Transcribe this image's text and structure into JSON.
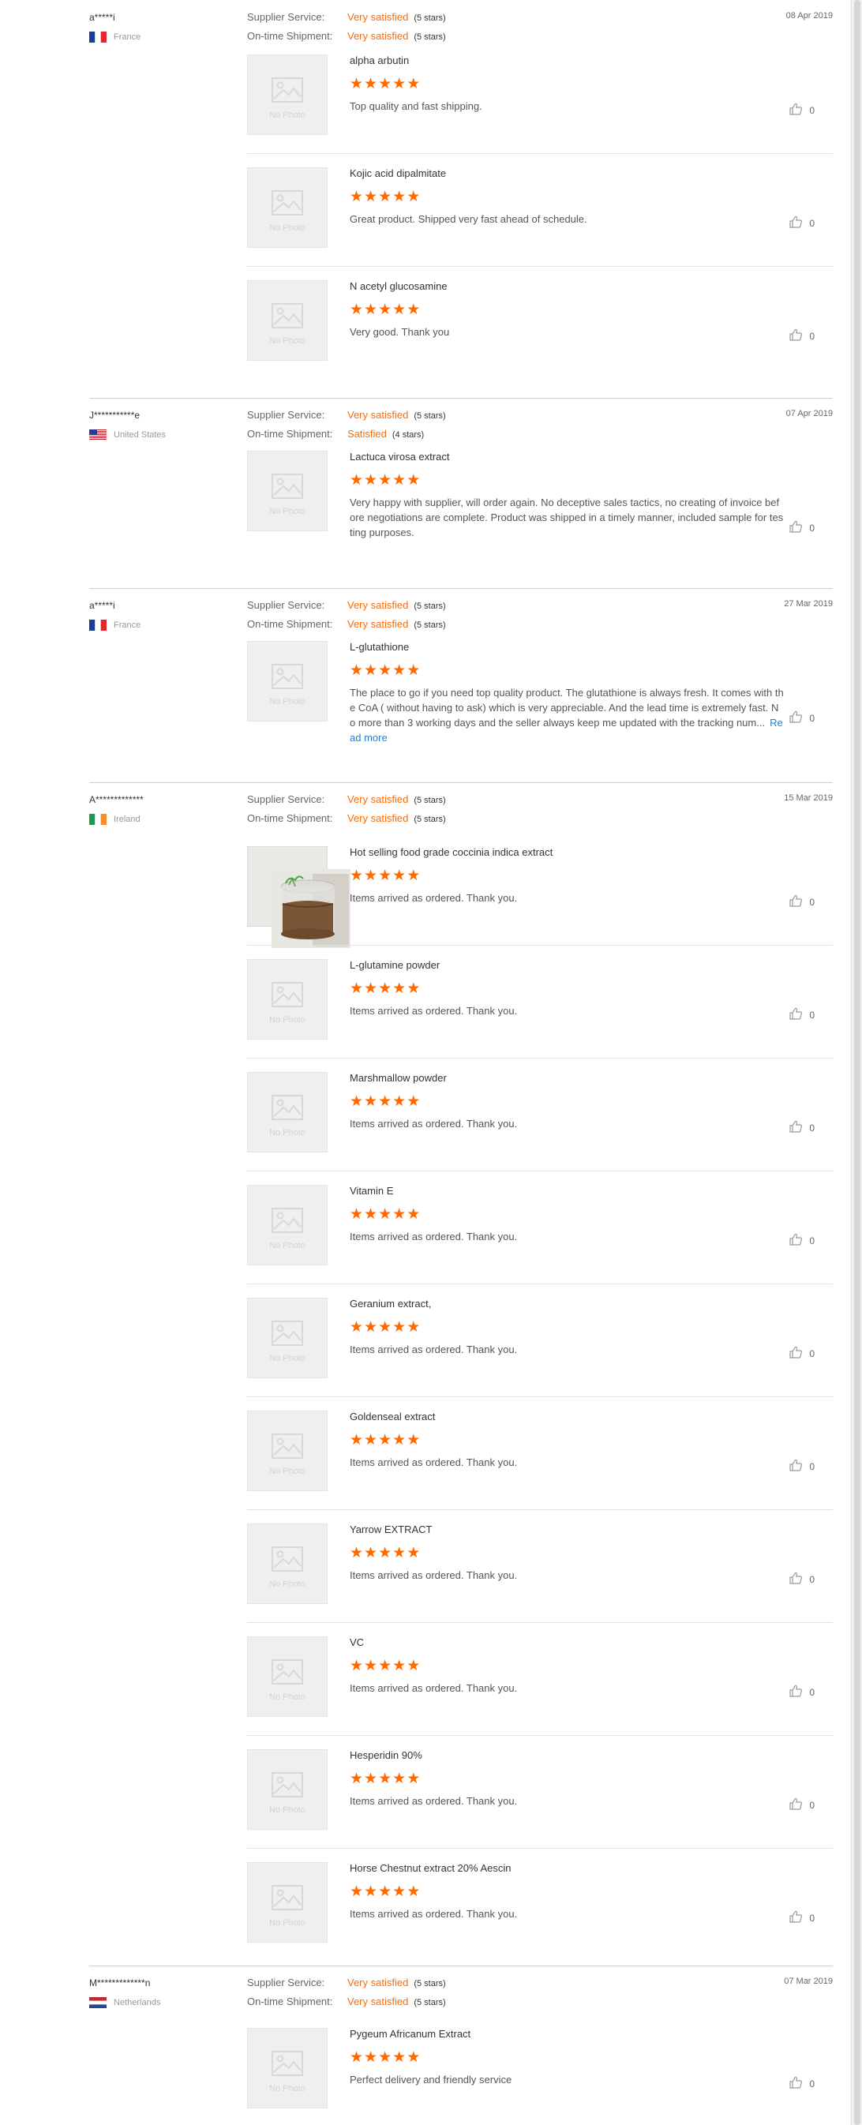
{
  "labels": {
    "supplier_service": "Supplier Service:",
    "ontime_shipment": "On-time Shipment:",
    "no_photo": "No Photo"
  },
  "reviews": [
    {
      "buyer": "a*****i",
      "country": "France",
      "flag": "france",
      "date": "08 Apr 2019",
      "supplier_service": {
        "value": "Very satisfied",
        "stars": "(5 stars)"
      },
      "ontime_shipment": {
        "value": "Very satisfied",
        "stars": "(5 stars)"
      },
      "items": [
        {
          "title": "alpha arbutin",
          "rating": 5,
          "text": "Top quality and fast shipping.",
          "likes": "0",
          "photo": "none"
        },
        {
          "title": "Kojic acid dipalmitate",
          "rating": 5,
          "text": "Great product. Shipped very fast ahead of schedule.",
          "likes": "0",
          "photo": "none"
        },
        {
          "title": "N acetyl glucosamine",
          "rating": 5,
          "text": "Very good. Thank you",
          "likes": "0",
          "photo": "none"
        }
      ]
    },
    {
      "buyer": "J***********e",
      "country": "United States",
      "flag": "usa",
      "date": "07 Apr 2019",
      "supplier_service": {
        "value": "Very satisfied",
        "stars": "(5 stars)"
      },
      "ontime_shipment": {
        "value": "Satisfied",
        "stars": "(4 stars)"
      },
      "items": [
        {
          "title": "Lactuca virosa extract",
          "rating": 5,
          "text": "Very happy with supplier, will order again. No deceptive sales tactics, no creating of invoice before negotiations are complete. Product was shipped in a timely manner, included sample for testing purposes.",
          "likes": "0",
          "photo": "none"
        }
      ]
    },
    {
      "buyer": "a*****i",
      "country": "France",
      "flag": "france",
      "date": "27 Mar 2019",
      "supplier_service": {
        "value": "Very satisfied",
        "stars": "(5 stars)"
      },
      "ontime_shipment": {
        "value": "Very satisfied",
        "stars": "(5 stars)"
      },
      "items": [
        {
          "title": "L-glutathione",
          "rating": 5,
          "text": "The place to go if you need top quality product. The glutathione is always fresh. It comes with the CoA ( without having to ask) which is very appreciable. And the lead time is extremely fast. No more than 3 working days and the seller always keep me updated with the tracking num...",
          "read_more": "Read more",
          "likes": "0",
          "photo": "none"
        }
      ]
    },
    {
      "buyer": "A*************",
      "country": "Ireland",
      "flag": "ireland",
      "date": "15 Mar 2019",
      "supplier_service": {
        "value": "Very satisfied",
        "stars": "(5 stars)"
      },
      "ontime_shipment": {
        "value": "Very satisfied",
        "stars": "(5 stars)"
      },
      "items": [
        {
          "title": "Hot selling food grade coccinia indica extract",
          "rating": 5,
          "text": "Items arrived as ordered. Thank you.",
          "likes": "0",
          "photo": "product"
        },
        {
          "title": "L-glutamine powder",
          "rating": 5,
          "text": "Items arrived as ordered. Thank you.",
          "likes": "0",
          "photo": "none"
        },
        {
          "title": "Marshmallow powder",
          "rating": 5,
          "text": "Items arrived as ordered. Thank you.",
          "likes": "0",
          "photo": "none"
        },
        {
          "title": "Vitamin E",
          "rating": 5,
          "text": "Items arrived as ordered. Thank you.",
          "likes": "0",
          "photo": "none"
        },
        {
          "title": "Geranium extract,",
          "rating": 5,
          "text": "Items arrived as ordered. Thank you.",
          "likes": "0",
          "photo": "none"
        },
        {
          "title": "Goldenseal extract",
          "rating": 5,
          "text": "Items arrived as ordered. Thank you.",
          "likes": "0",
          "photo": "none"
        },
        {
          "title": "Yarrow EXTRACT",
          "rating": 5,
          "text": "Items arrived as ordered. Thank you.",
          "likes": "0",
          "photo": "none"
        },
        {
          "title": "VC",
          "rating": 5,
          "text": "Items arrived as ordered. Thank you.",
          "likes": "0",
          "photo": "none"
        },
        {
          "title": "Hesperidin 90%",
          "rating": 5,
          "text": "Items arrived as ordered. Thank you.",
          "likes": "0",
          "photo": "none"
        },
        {
          "title": "Horse Chestnut extract 20% Aescin",
          "rating": 5,
          "text": "Items arrived as ordered. Thank you.",
          "likes": "0",
          "photo": "none"
        }
      ]
    },
    {
      "buyer": "M*************n",
      "country": "Netherlands",
      "flag": "netherlands",
      "date": "07 Mar 2019",
      "supplier_service": {
        "value": "Very satisfied",
        "stars": "(5 stars)"
      },
      "ontime_shipment": {
        "value": "Very satisfied",
        "stars": "(5 stars)"
      },
      "items": [
        {
          "title": "Pygeum Africanum Extract",
          "rating": 5,
          "text": "Perfect delivery and friendly service",
          "likes": "0",
          "photo": "none"
        }
      ]
    }
  ],
  "colors": {
    "accent": "#ff6a00",
    "link": "#2a7dc9"
  }
}
